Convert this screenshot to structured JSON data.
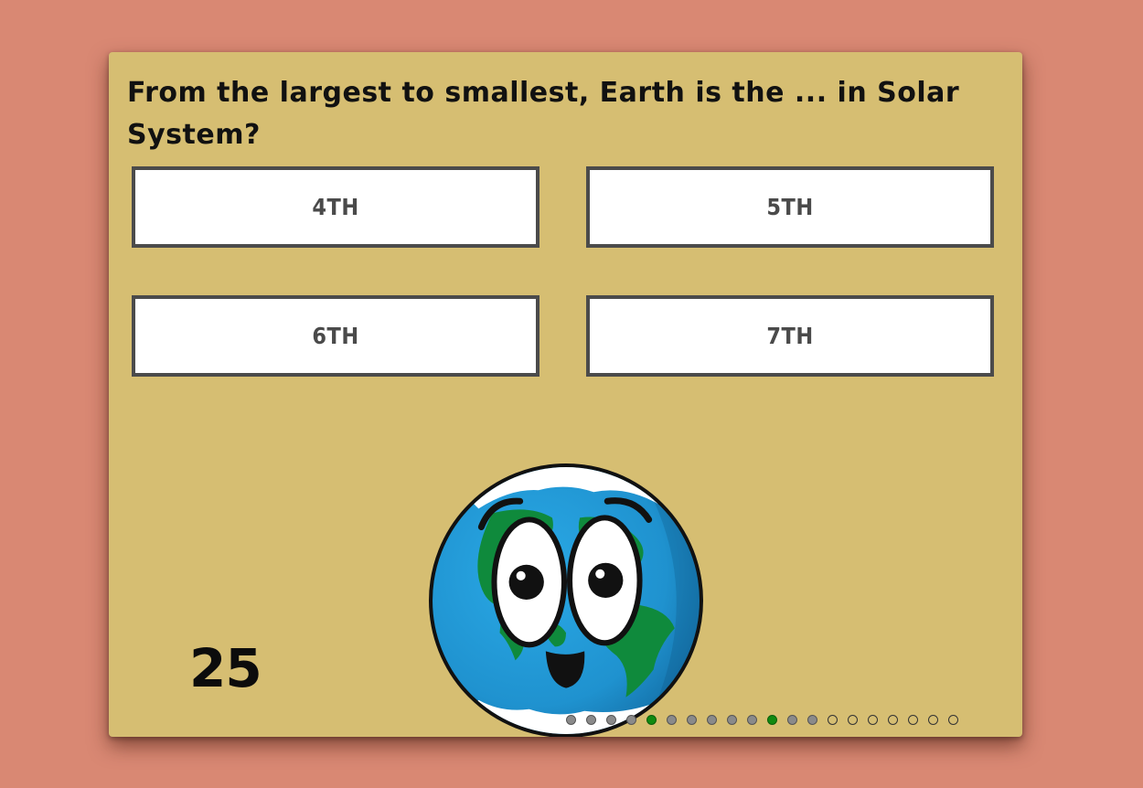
{
  "quiz": {
    "question": "From the largest to smallest, Earth is the ... in Solar System?",
    "answers": [
      "4TH",
      "5TH",
      "6TH",
      "7TH"
    ],
    "timer": "25",
    "mascot_icon": "earth-mascot-icon",
    "progress": [
      "answered",
      "answered",
      "answered",
      "answered",
      "correct",
      "answered",
      "answered",
      "answered",
      "answered",
      "answered",
      "correct",
      "answered",
      "answered",
      "pending",
      "pending",
      "pending",
      "pending",
      "pending",
      "pending",
      "pending"
    ]
  },
  "colors": {
    "background": "#d98873",
    "card": "#d6be72",
    "answer_border": "#4b4b4b",
    "dot_answered": "#8a8a8a",
    "dot_correct": "#118a11"
  }
}
